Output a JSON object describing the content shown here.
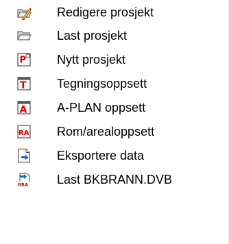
{
  "menu": {
    "items": [
      {
        "label": "Redigere prosjekt",
        "icon": "folder-edit-icon"
      },
      {
        "label": "Last prosjekt",
        "icon": "folder-open-icon"
      },
      {
        "label": "Nytt prosjekt",
        "icon": "new-project-p-icon"
      },
      {
        "label": "Tegningsoppsett",
        "icon": "drawing-setup-t-icon"
      },
      {
        "label": "A-PLAN oppsett",
        "icon": "aplan-setup-a-icon"
      },
      {
        "label": "Rom/arealoppsett",
        "icon": "room-area-ra-icon"
      },
      {
        "label": "Eksportere data",
        "icon": "export-data-icon"
      },
      {
        "label": "Last BKBRANN.DVB",
        "icon": "load-dvb-icon"
      }
    ]
  },
  "colors": {
    "icon_red": "#e00000",
    "icon_blue": "#1a5fd0",
    "folder_gray": "#8a8a8a",
    "text": "#000000"
  }
}
